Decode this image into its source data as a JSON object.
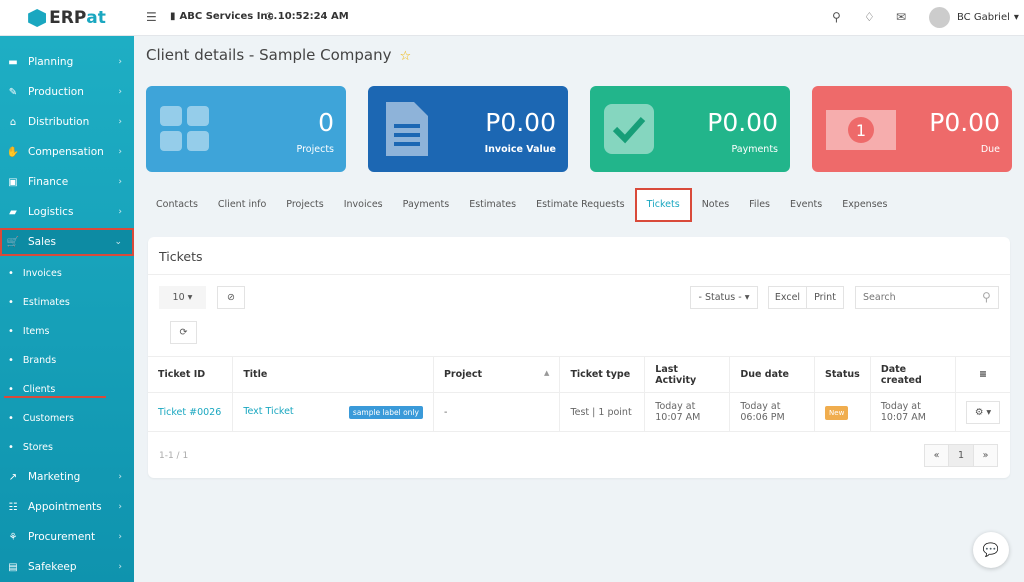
{
  "brand": {
    "name_a": "ERP",
    "name_b": "at"
  },
  "topbar": {
    "company": "ABC Services Inc.",
    "time": "10:52:24 AM",
    "user": "BC Gabriel"
  },
  "sidebar": {
    "items": [
      {
        "label": "Planning",
        "icon": "briefcase-icon"
      },
      {
        "label": "Production",
        "icon": "flask-icon"
      },
      {
        "label": "Distribution",
        "icon": "bank-icon"
      },
      {
        "label": "Compensation",
        "icon": "handshake-icon"
      },
      {
        "label": "Finance",
        "icon": "money-icon"
      },
      {
        "label": "Logistics",
        "icon": "truck-icon"
      },
      {
        "label": "Sales",
        "icon": "cart-icon"
      }
    ],
    "sales_sub": [
      "Invoices",
      "Estimates",
      "Items",
      "Brands",
      "Clients",
      "Customers",
      "Stores"
    ],
    "items_after": [
      {
        "label": "Marketing"
      },
      {
        "label": "Appointments"
      },
      {
        "label": "Procurement"
      },
      {
        "label": "Safekeep"
      }
    ]
  },
  "page": {
    "title": "Client details - Sample Company"
  },
  "cards": [
    {
      "value": "0",
      "label": "Projects",
      "color": "#3ea4d9"
    },
    {
      "value": "P0.00",
      "label": "Invoice Value",
      "color": "#1c67b3"
    },
    {
      "value": "P0.00",
      "label": "Payments",
      "color": "#22b58b"
    },
    {
      "value": "P0.00",
      "label": "Due",
      "color": "#ee6a6a"
    }
  ],
  "tabs": [
    "Contacts",
    "Client info",
    "Projects",
    "Invoices",
    "Payments",
    "Estimates",
    "Estimate Requests",
    "Tickets",
    "Notes",
    "Files",
    "Events",
    "Expenses"
  ],
  "tickets": {
    "heading": "Tickets",
    "page_size": "10",
    "status_filter": "- Status -",
    "excel": "Excel",
    "print": "Print",
    "search_placeholder": "Search",
    "columns": [
      "Ticket ID",
      "Title",
      "Project",
      "Ticket type",
      "Last Activity",
      "Due date",
      "Status",
      "Date created"
    ],
    "rows": [
      {
        "id": "Ticket #0026",
        "title": "Text Ticket",
        "label": "sample label only",
        "project": "-",
        "type": "Test | 1 point",
        "last_activity": "Today at 10:07 AM",
        "due": "Today at 06:06 PM",
        "status": "New",
        "created": "Today at 10:07 AM"
      }
    ],
    "range": "1-1 / 1",
    "page": "1",
    "prev": "«",
    "next": "»"
  }
}
